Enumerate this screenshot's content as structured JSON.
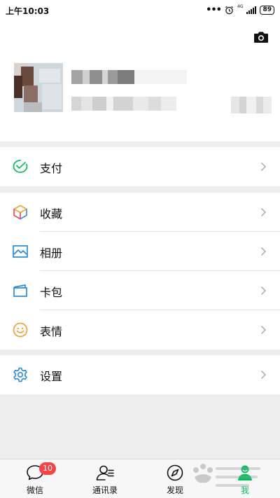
{
  "status_bar": {
    "time": "上午10:03",
    "dots": "•••",
    "network": "4G",
    "battery": "89"
  },
  "profile": {
    "camera_icon": "camera-icon",
    "avatar": "avatar-image"
  },
  "menu": {
    "pay": {
      "label": "支付",
      "icon": "wallet-check-icon"
    },
    "favorites": {
      "label": "收藏",
      "icon": "cube-icon"
    },
    "album": {
      "label": "相册",
      "icon": "image-icon"
    },
    "cards": {
      "label": "卡包",
      "icon": "card-wallet-icon"
    },
    "stickers": {
      "label": "表情",
      "icon": "smiley-icon"
    },
    "settings": {
      "label": "设置",
      "icon": "gear-icon"
    }
  },
  "tabbar": {
    "tabs": [
      {
        "label": "微信",
        "icon": "chat-bubble-icon",
        "badge": "10"
      },
      {
        "label": "通讯录",
        "icon": "contacts-icon"
      },
      {
        "label": "发现",
        "icon": "compass-icon"
      },
      {
        "label": "我",
        "icon": "person-icon",
        "active": true
      }
    ]
  },
  "colors": {
    "accent_green": "#07c160",
    "badge_red": "#f54545",
    "background": "#ededed"
  }
}
